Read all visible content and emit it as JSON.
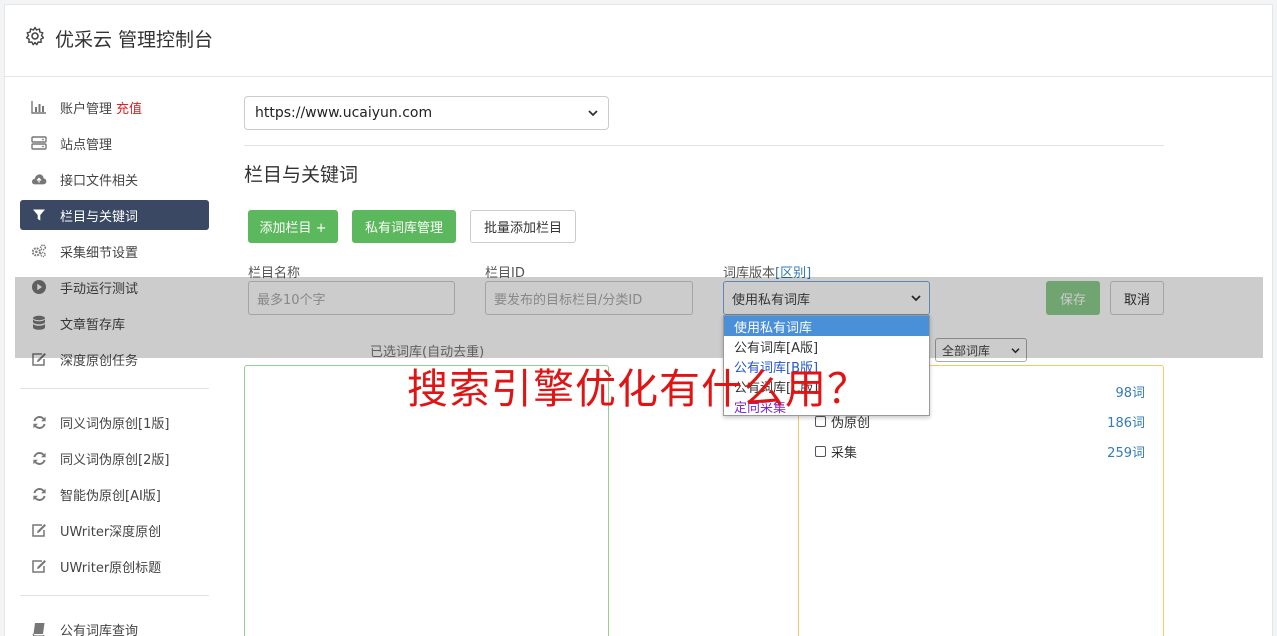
{
  "header": {
    "title": "优采云 管理控制台"
  },
  "sidebar": {
    "group1": [
      {
        "label": "账户管理",
        "badge": "充值",
        "icon": "bar-chart-icon"
      },
      {
        "label": "站点管理",
        "icon": "server-icon"
      },
      {
        "label": "接口文件相关",
        "icon": "cloud-upload-icon"
      },
      {
        "label": "栏目与关键词",
        "icon": "filter-icon",
        "active": true
      },
      {
        "label": "采集细节设置",
        "icon": "gears-icon"
      },
      {
        "label": "手动运行测试",
        "icon": "play-icon"
      },
      {
        "label": "文章暂存库",
        "icon": "database-icon"
      },
      {
        "label": "深度原创任务",
        "icon": "edit-icon"
      }
    ],
    "group2": [
      {
        "label": "同义词伪原创[1版]",
        "icon": "refresh-icon"
      },
      {
        "label": "同义词伪原创[2版]",
        "icon": "refresh-icon"
      },
      {
        "label": "智能伪原创[AI版]",
        "icon": "refresh-icon"
      },
      {
        "label": "UWriter深度原创",
        "icon": "edit-icon"
      },
      {
        "label": "UWriter原创标题",
        "icon": "edit-icon"
      }
    ],
    "group3": [
      {
        "label": "公有词库查询",
        "icon": "book-icon"
      }
    ]
  },
  "main": {
    "site_select": "https://www.ucaiyun.com",
    "section_title": "栏目与关键词",
    "buttons": {
      "add_column": "添加栏目 +",
      "private_lib": "私有词库管理",
      "batch_add": "批量添加栏目"
    },
    "form": {
      "name_label": "栏目名称",
      "name_placeholder": "最多10个字",
      "id_label": "栏目ID",
      "id_placeholder": "要发布的目标栏目/分类ID",
      "version_label": "词库版本",
      "version_link": "[区别]",
      "version_value": "使用私有词库",
      "save": "保存",
      "cancel": "取消"
    },
    "selected_label": "已选词库(自动去重)",
    "filter_value": "全部词库",
    "dropdown_options": [
      "使用私有词库",
      "公有词库[A版]",
      "公有词库[B版]",
      "公有词库[C版]",
      "定向采集"
    ],
    "libraries": [
      {
        "name": "",
        "count": "98词"
      },
      {
        "name": "伪原创",
        "count": "186词"
      },
      {
        "name": "采集",
        "count": "259词"
      }
    ]
  },
  "watermark": "搜索引擎优化有什么用？"
}
